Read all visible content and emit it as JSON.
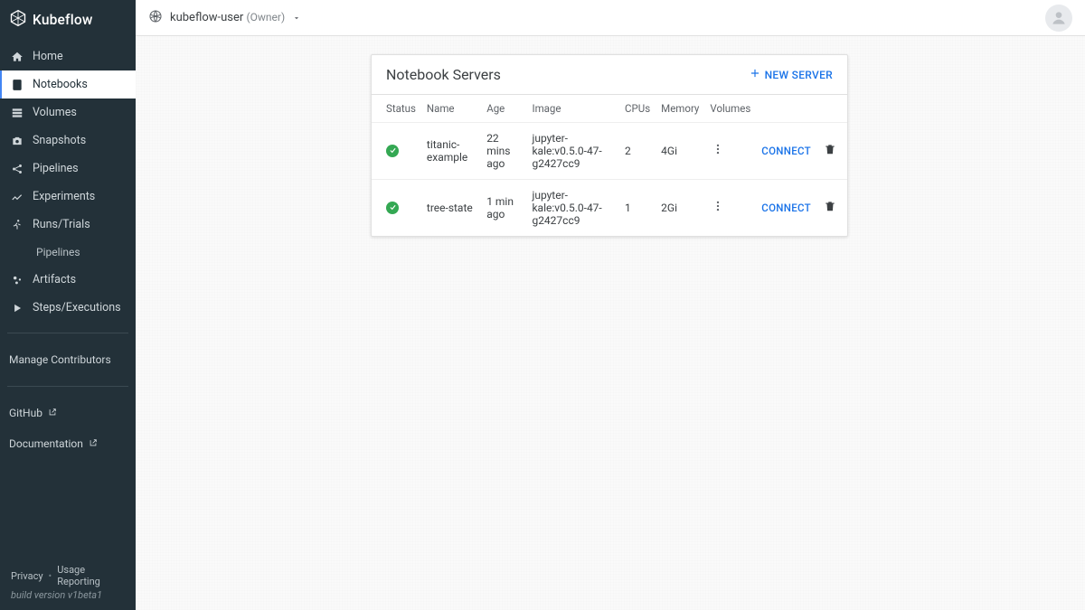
{
  "brand": "Kubeflow",
  "sidebar": {
    "items": [
      {
        "label": "Home"
      },
      {
        "label": "Notebooks"
      },
      {
        "label": "Volumes"
      },
      {
        "label": "Snapshots"
      },
      {
        "label": "Pipelines"
      },
      {
        "label": "Experiments"
      },
      {
        "label": "Runs/Trials"
      },
      {
        "label": "Pipelines"
      },
      {
        "label": "Artifacts"
      },
      {
        "label": "Steps/Executions"
      }
    ],
    "manage": "Manage Contributors",
    "github": "GitHub",
    "documentation": "Documentation"
  },
  "footer": {
    "privacy": "Privacy",
    "usage": "Usage Reporting",
    "build": "build version v1beta1"
  },
  "topbar": {
    "namespace": "kubeflow-user",
    "role": "(Owner)"
  },
  "panel": {
    "title": "Notebook Servers",
    "new_server": "NEW SERVER",
    "columns": {
      "status": "Status",
      "name": "Name",
      "age": "Age",
      "image": "Image",
      "cpus": "CPUs",
      "memory": "Memory",
      "volumes": "Volumes"
    },
    "rows": [
      {
        "name": "titanic-example",
        "age": "22 mins ago",
        "image": "jupyter-kale:v0.5.0-47-g2427cc9",
        "cpus": "2",
        "memory": "4Gi",
        "connect": "CONNECT"
      },
      {
        "name": "tree-state",
        "age": "1 min ago",
        "image": "jupyter-kale:v0.5.0-47-g2427cc9",
        "cpus": "1",
        "memory": "2Gi",
        "connect": "CONNECT"
      }
    ]
  }
}
